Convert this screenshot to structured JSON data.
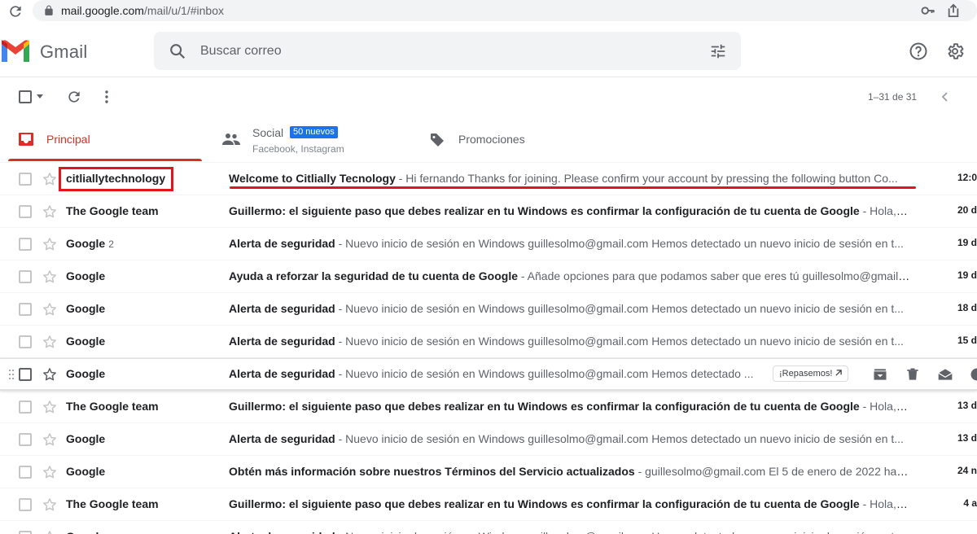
{
  "browser": {
    "url_host": "mail.google.com",
    "url_path": "/mail/u/1/#inbox"
  },
  "header": {
    "app_name": "Gmail",
    "search_placeholder": "Buscar correo"
  },
  "toolbar": {
    "count_text": "1–31 de 31"
  },
  "tabs": [
    {
      "label": "Principal",
      "active": true
    },
    {
      "label": "Social",
      "badge": "50 nuevos",
      "sub": "Facebook, Instagram"
    },
    {
      "label": "Promociones"
    }
  ],
  "emails": [
    {
      "sender": "citliallytechnology",
      "count": "",
      "subject": "Welcome to Citlially Tecnology",
      "snippet": " - Hi fernando Thanks for joining. Please confirm your account by pressing the following button Co...",
      "date": "12:0"
    },
    {
      "sender": "The Google team",
      "count": "",
      "subject": "Guillermo: el siguiente paso que debes realizar en tu Windows es confirmar la configuración de tu cuenta de Google",
      "snippet": " - Hola, Gui...",
      "date": "20 d"
    },
    {
      "sender": "Google",
      "count": "2",
      "subject": "Alerta de seguridad",
      "snippet": " - Nuevo inicio de sesión en Windows guillesolmo@gmail.com Hemos detectado un nuevo inicio de sesión en t...",
      "date": "19 d"
    },
    {
      "sender": "Google",
      "count": "",
      "subject": "Ayuda a reforzar la seguridad de tu cuenta de Google",
      "snippet": " - Añade opciones para que podamos saber que eres tú guillesolmo@gmail....",
      "date": "19 d"
    },
    {
      "sender": "Google",
      "count": "",
      "subject": "Alerta de seguridad",
      "snippet": " - Nuevo inicio de sesión en Windows guillesolmo@gmail.com Hemos detectado un nuevo inicio de sesión en t...",
      "date": "18 d"
    },
    {
      "sender": "Google",
      "count": "",
      "subject": "Alerta de seguridad",
      "snippet": " - Nuevo inicio de sesión en Windows guillesolmo@gmail.com Hemos detectado un nuevo inicio de sesión en t...",
      "date": "15 d"
    },
    {
      "sender": "Google",
      "count": "",
      "subject": "Alerta de seguridad",
      "snippet": " - Nuevo inicio de sesión en Windows guillesolmo@gmail.com Hemos detectado ...",
      "date": "",
      "chip": "¡Repasemos!"
    },
    {
      "sender": "The Google team",
      "count": "",
      "subject": "Guillermo: el siguiente paso que debes realizar en tu Windows es confirmar la configuración de tu cuenta de Google",
      "snippet": " - Hola, Gui...",
      "date": "13 d"
    },
    {
      "sender": "Google",
      "count": "",
      "subject": "Alerta de seguridad",
      "snippet": " - Nuevo inicio de sesión en Windows guillesolmo@gmail.com Hemos detectado un nuevo inicio de sesión en t...",
      "date": "13 d"
    },
    {
      "sender": "Google",
      "count": "",
      "subject": "Obtén más información sobre nuestros Términos del Servicio actualizados",
      "snippet": " - guillesolmo@gmail.com El 5 de enero de 2022 hare...",
      "date": "24 n"
    },
    {
      "sender": "The Google team",
      "count": "",
      "subject": "Guillermo: el siguiente paso que debes realizar en tu Windows es confirmar la configuración de tu cuenta de Google",
      "snippet": " - Hola, Gui...",
      "date": "4 a"
    },
    {
      "sender": "Google",
      "count": "",
      "subject": "Alerta de seguridad",
      "snippet": " - Nuevo inicio de sesión en Windows guillesolmo@gmail.com Hemos detectado un nuevo inicio de sesión en t...",
      "date": ""
    }
  ],
  "colors": {
    "accent_red": "#d93025",
    "annotation_red": "#e0161b",
    "badge_blue": "#1a73e8"
  }
}
